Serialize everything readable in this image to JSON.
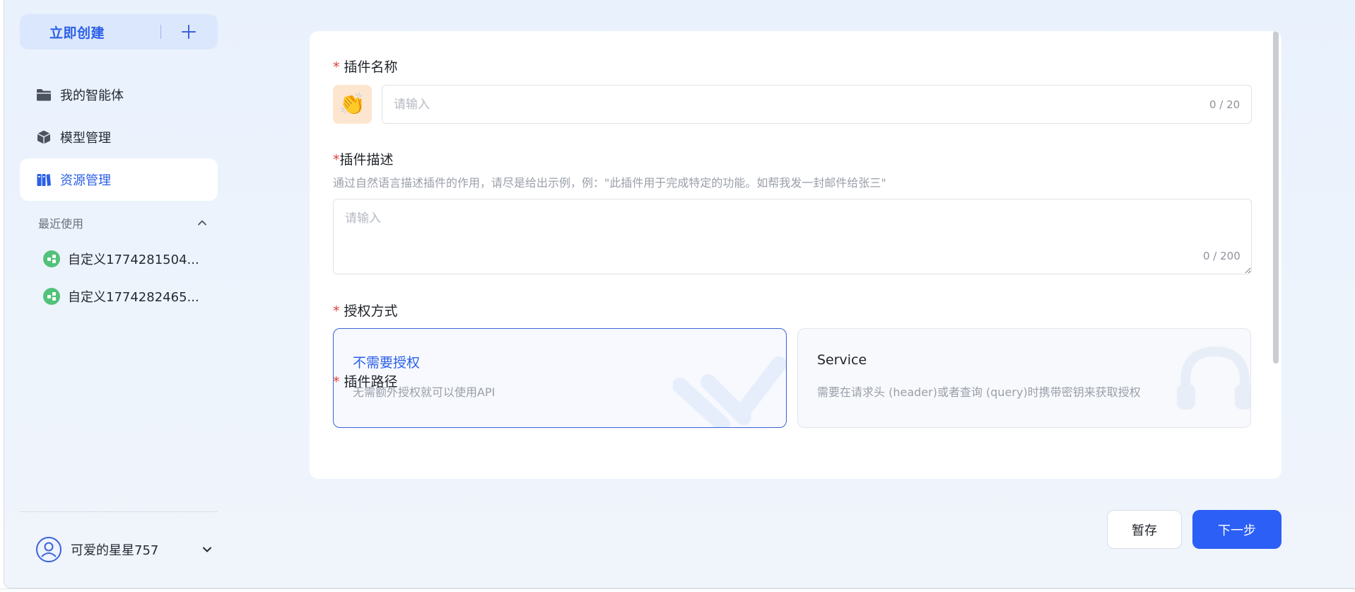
{
  "sidebar": {
    "create_label": "立即创建",
    "nav": [
      {
        "label": "我的智能体",
        "icon": "folder-icon"
      },
      {
        "label": "模型管理",
        "icon": "cube-icon"
      },
      {
        "label": "资源管理",
        "icon": "resource-icon",
        "active": true
      }
    ],
    "recent_title": "最近使用",
    "recent": [
      {
        "label": "自定义1774281504..."
      },
      {
        "label": "自定义1774282465..."
      }
    ],
    "user_name": "可爱的星星757"
  },
  "form": {
    "name_label": "插件名称",
    "name_placeholder": "请输入",
    "name_counter": "0 / 20",
    "desc_label": "插件描述",
    "desc_hint": "通过自然语言描述插件的作用，请尽是给出示例，例：\"此插件用于完成特定的功能。如帮我发一封邮件给张三\"",
    "desc_placeholder": "请输入",
    "desc_counter": "0 / 200",
    "auth_label": "授权方式",
    "auth_options": [
      {
        "title": "不需要授权",
        "desc": "无需额外授权就可以使用API",
        "selected": true
      },
      {
        "title": "Service",
        "desc": "需要在请求头 (header)或者查询 (query)时携带密钥来获取授权",
        "selected": false
      }
    ],
    "path_label": "插件路径"
  },
  "actions": {
    "save_label": "暂存",
    "next_label": "下一步"
  },
  "colors": {
    "accent": "#2b5fe8",
    "primary_button": "#2b5ff5",
    "required": "#e0403a",
    "recent_dot": "#52c27a"
  }
}
